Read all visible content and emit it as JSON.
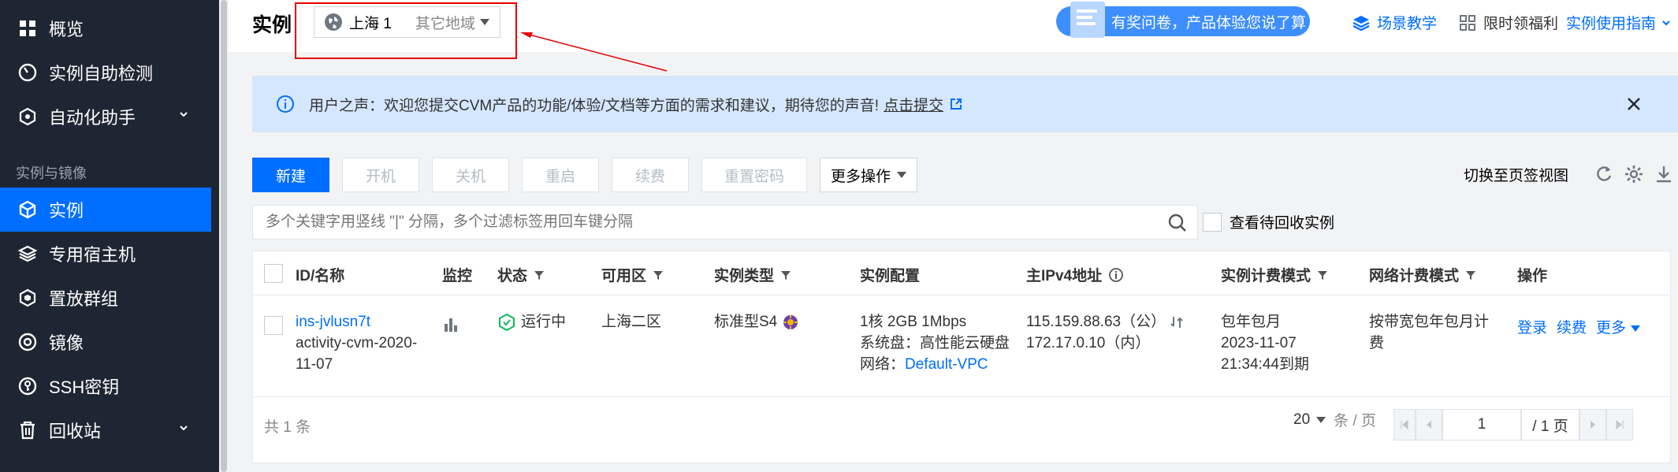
{
  "sidebar": {
    "items": [
      {
        "label": "概览",
        "icon": "grid-icon"
      },
      {
        "label": "实例自助检测",
        "icon": "gauge-icon"
      },
      {
        "label": "自动化助手",
        "icon": "robot-icon"
      },
      {
        "label": "实例",
        "icon": "cube-icon"
      },
      {
        "label": "专用宿主机",
        "icon": "layers-icon"
      },
      {
        "label": "置放群组",
        "icon": "hex-icon"
      },
      {
        "label": "镜像",
        "icon": "disc-icon"
      },
      {
        "label": "SSH密钥",
        "icon": "key-icon"
      },
      {
        "label": "回收站",
        "icon": "trash-icon"
      }
    ],
    "group_title": "实例与镜像",
    "active_color": "#006eff"
  },
  "header": {
    "title": "实例",
    "region_current": "上海 1",
    "region_other": "其它地域",
    "survey_text": "有奖问卷，产品体验您说了算",
    "links": [
      "场景教学",
      "限时领福利",
      "实例使用指南"
    ]
  },
  "notice": {
    "text": "用户之声：欢迎您提交CVM产品的功能/体验/文档等方面的需求和建议，期待您的声音!",
    "link": "点击提交"
  },
  "toolbar": {
    "new": "新建",
    "start": "开机",
    "stop": "关机",
    "restart": "重启",
    "renew": "续费",
    "reset_pwd": "重置密码",
    "more": "更多操作",
    "switch_view": "切换至页签视图"
  },
  "search": {
    "placeholder": "多个关键字用竖线 \"|\" 分隔，多个过滤标签用回车键分隔",
    "recycle_label": "查看待回收实例"
  },
  "table": {
    "headers": [
      "ID/名称",
      "监控",
      "状态",
      "可用区",
      "实例类型",
      "实例配置",
      "主IPv4地址",
      "实例计费模式",
      "网络计费模式",
      "操作"
    ],
    "row": {
      "id": "ins-jvlusn7t",
      "name_line1": "activity-cvm-2020-",
      "name_line2": "11-07",
      "status": "运行中",
      "zone": "上海二区",
      "type": "标准型S4",
      "config_line1": "1核 2GB 1Mbps",
      "config_line2": "系统盘：高性能云硬盘",
      "config_net_label": "网络：",
      "config_net_link": "Default-VPC",
      "ip_public": "115.159.88.63（公）",
      "ip_private": "172.17.0.10（内）",
      "billing_line1": "包年包月",
      "billing_line2": "2023-11-07",
      "billing_line3": "21:34:44到期",
      "net_billing_line1": "按带宽包年包月计",
      "net_billing_line2": "费",
      "op_login": "登录",
      "op_renew": "续费",
      "op_more": "更多"
    },
    "total_prefix": "共",
    "total_count": "1",
    "total_suffix": "条",
    "page_size": "20",
    "page_size_unit": "条 / 页",
    "page_current": "1",
    "page_total": "/ 1 页"
  }
}
